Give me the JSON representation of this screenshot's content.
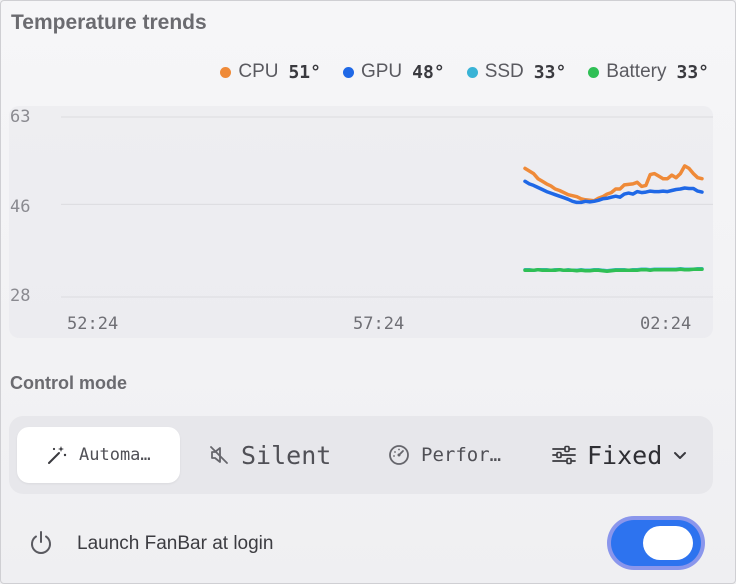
{
  "header": {
    "title": "Temperature trends"
  },
  "legend": [
    {
      "label": "CPU",
      "value": "51°",
      "color": "#ef8a38"
    },
    {
      "label": "GPU",
      "value": "48°",
      "color": "#1f68e6"
    },
    {
      "label": "SSD",
      "value": "33°",
      "color": "#39b3d6"
    },
    {
      "label": "Battery",
      "value": "33°",
      "color": "#2fbf55"
    }
  ],
  "chart_data": {
    "type": "line",
    "ylim": [
      28,
      63
    ],
    "yticks": [
      "63",
      "46",
      "28"
    ],
    "xticks": [
      "52:24",
      "57:24",
      "02:24"
    ],
    "grid": true,
    "series": [
      {
        "name": "CPU",
        "color": "#ef8a38",
        "values": [
          53,
          52.5,
          52,
          51,
          50.5,
          50,
          49.6,
          49,
          48.7,
          48.3,
          47.9,
          47.7,
          47.5,
          47.1,
          46.9,
          46.8,
          46.7,
          47.2,
          47.5,
          48,
          48.3,
          49,
          49,
          49.8,
          49.9,
          50,
          50.3,
          49.5,
          49.7,
          51.8,
          52,
          51.5,
          51,
          51,
          51.7,
          51.2,
          52,
          53.5,
          53,
          52,
          51.2,
          51
        ]
      },
      {
        "name": "GPU",
        "color": "#1f68e6",
        "values": [
          50.5,
          50,
          49.7,
          49.3,
          48.9,
          48.5,
          48.2,
          47.9,
          47.6,
          47.3,
          47,
          46.6,
          46.4,
          46.4,
          46.6,
          46.5,
          46.6,
          46.8,
          47.1,
          47.2,
          47.4,
          47.6,
          47.4,
          48,
          48.2,
          48,
          48.5,
          48.3,
          48.4,
          48.6,
          48.5,
          48.5,
          48.6,
          48.5,
          48.7,
          48.9,
          49,
          49.2,
          49.1,
          49.1,
          48.6,
          48.4
        ]
      },
      {
        "name": "SSD",
        "color": "#39b3d6",
        "values": [
          33.3,
          33.3,
          33.2,
          33.3,
          33.3,
          33.3,
          33.2,
          33.3,
          33.3,
          33.2,
          33.3,
          33.2,
          33.2,
          33.3,
          33.2,
          33.2,
          33.3,
          33.3,
          33.2,
          33.1,
          33.2,
          33.3,
          33.3,
          33.3,
          33.2,
          33.3,
          33.3,
          33.4,
          33.4,
          33.3,
          33.4,
          33.4,
          33.4,
          33.4,
          33.4,
          33.4,
          33.5,
          33.4,
          33.4,
          33.4,
          33.5,
          33.5
        ]
      },
      {
        "name": "Battery",
        "color": "#2fbf55",
        "values": [
          33.2,
          33.2,
          33.2,
          33.3,
          33.2,
          33.2,
          33.2,
          33.2,
          33.3,
          33.2,
          33.2,
          33.2,
          33.1,
          33.2,
          33.1,
          33.1,
          33.2,
          33.2,
          33.1,
          33.0,
          33.1,
          33.2,
          33.2,
          33.2,
          33.2,
          33.2,
          33.2,
          33.3,
          33.3,
          33.2,
          33.3,
          33.3,
          33.3,
          33.3,
          33.3,
          33.3,
          33.4,
          33.3,
          33.3,
          33.4,
          33.4,
          33.4
        ]
      }
    ]
  },
  "control": {
    "label": "Control mode",
    "modes": [
      {
        "label": "Automa…",
        "icon": "magic-wand-icon",
        "active": true
      },
      {
        "label": "Silent",
        "icon": "speaker-mute-icon",
        "active": false
      },
      {
        "label": "Perfor…",
        "icon": "gauge-icon",
        "active": false
      },
      {
        "label": "Fixed",
        "icon": "sliders-icon",
        "active": false
      }
    ]
  },
  "footer": {
    "launch_label": "Launch FanBar at login",
    "launch_enabled": true,
    "accent_color": "#2d73ef"
  }
}
